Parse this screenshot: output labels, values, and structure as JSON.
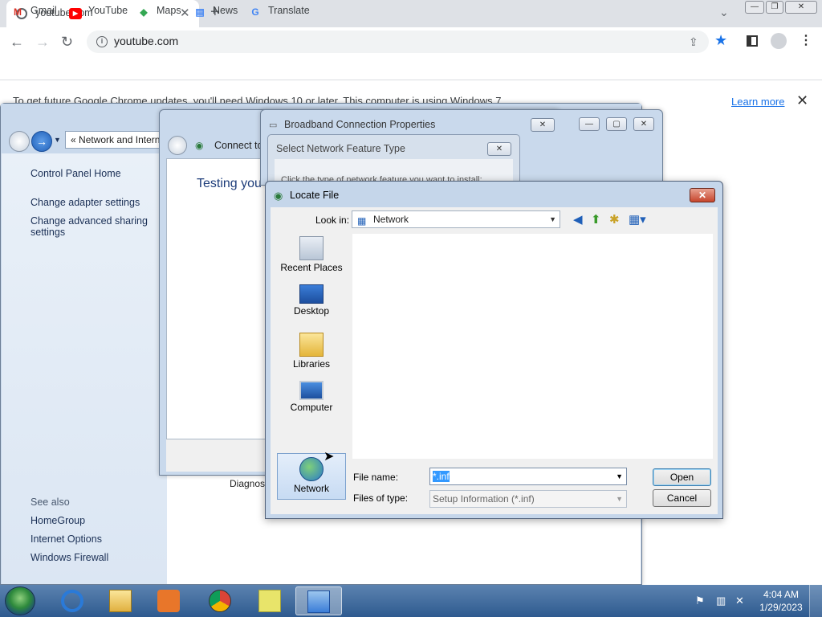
{
  "chrome": {
    "tab_title": "youtube.com",
    "tab_close": "✕",
    "new_tab": "+",
    "tab_dropdown": "⌄",
    "url": "youtube.com",
    "win_minimize": "—",
    "win_restore": "❐",
    "win_close": "✕",
    "bookmarks": [
      {
        "label": "Gmail",
        "icon": "gmail-icon",
        "color": "#d93025"
      },
      {
        "label": "YouTube",
        "icon": "youtube-icon",
        "color": "#ff0000"
      },
      {
        "label": "Maps",
        "icon": "maps-icon",
        "color": "#34a853"
      },
      {
        "label": "News",
        "icon": "news-icon",
        "color": "#4285f4"
      },
      {
        "label": "Translate",
        "icon": "translate-icon",
        "color": "#4285f4"
      }
    ],
    "infobar": {
      "message": "To get future Google Chrome updates, you'll need Windows 10 or later. This computer is using Windows 7.",
      "learn_more": "Learn more",
      "close": "✕"
    },
    "accent_color": "#1a73e8"
  },
  "control_panel": {
    "address": "Network and Internet",
    "address_prefix": "«",
    "links": [
      "Control Panel Home",
      "Change adapter settings",
      "Change advanced sharing settings"
    ],
    "see_also_heading": "See also",
    "see_also": [
      "HomeGroup",
      "Internet Options",
      "Windows Firewall"
    ],
    "content_peek": "Diagnose"
  },
  "connect_window": {
    "title": "Connect to",
    "body_text": "Testing you"
  },
  "broadband_window": {
    "title": "Broadband Connection Properties"
  },
  "network_feature_window": {
    "title": "Select Network Feature Type",
    "body_peek": "Click the type of network feature you want to install:"
  },
  "locate_file": {
    "title": "Locate File",
    "close": "✕",
    "look_in_label": "Look in:",
    "look_in_value": "Network",
    "places": [
      {
        "label": "Recent Places",
        "icon": "recent-places-icon"
      },
      {
        "label": "Desktop",
        "icon": "desktop-icon"
      },
      {
        "label": "Libraries",
        "icon": "libraries-icon"
      },
      {
        "label": "Computer",
        "icon": "computer-icon"
      },
      {
        "label": "Network",
        "icon": "network-icon",
        "selected": true
      }
    ],
    "file_name_label": "File name:",
    "file_name_value": "*.inf",
    "files_of_type_label": "Files of type:",
    "files_of_type_value": "Setup Information (*.inf)",
    "open_button": "Open",
    "cancel_button": "Cancel"
  },
  "taskbar": {
    "apps": [
      {
        "name": "internet-explorer-icon"
      },
      {
        "name": "windows-explorer-icon"
      },
      {
        "name": "media-player-icon"
      },
      {
        "name": "chrome-icon"
      },
      {
        "name": "sticky-notes-icon"
      },
      {
        "name": "control-panel-icon",
        "active": true
      }
    ],
    "time": "4:04 AM",
    "date": "1/29/2023"
  }
}
